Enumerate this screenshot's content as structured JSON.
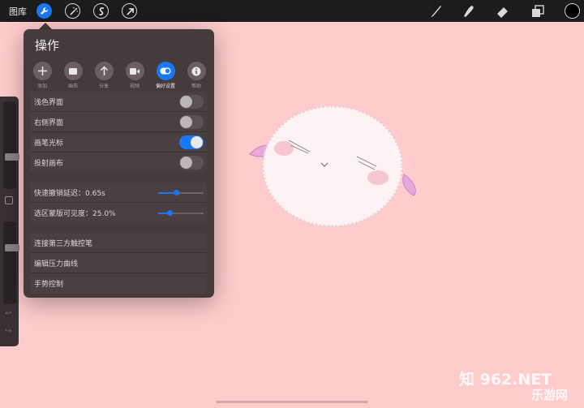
{
  "topbar": {
    "gallery_label": "图库",
    "left_tools": [
      "wrench-icon",
      "magic-wand-icon",
      "selection-icon",
      "transform-arrow-icon"
    ],
    "right_tools": [
      "brush-icon",
      "smudge-icon",
      "eraser-icon",
      "layers-icon"
    ],
    "current_color": "#000000"
  },
  "actions_panel": {
    "title": "操作",
    "tabs": [
      {
        "label": "添加",
        "icon": "plus-icon"
      },
      {
        "label": "画布",
        "icon": "canvas-icon"
      },
      {
        "label": "分享",
        "icon": "share-icon"
      },
      {
        "label": "视频",
        "icon": "video-icon"
      },
      {
        "label": "偏好设置",
        "icon": "toggle-icon",
        "active": true
      },
      {
        "label": "帮助",
        "icon": "info-icon"
      }
    ],
    "toggles": [
      {
        "label": "浅色界面",
        "on": false
      },
      {
        "label": "右侧界面",
        "on": false
      },
      {
        "label": "画笔光标",
        "on": true
      },
      {
        "label": "投射画布",
        "on": false
      }
    ],
    "sliders": [
      {
        "label": "快速撤销延迟：0.65s",
        "level": 0.4
      },
      {
        "label": "选区蒙版可见度：25.0%",
        "level": 0.25
      }
    ],
    "links": [
      "连接第三方触控笔",
      "编辑压力曲线",
      "手势控制"
    ]
  },
  "sidebar": {
    "brush_size_level": 0.35,
    "opacity_level": 0.7
  },
  "accent_color": "#1a78f2",
  "canvas_color": "#ffcccd",
  "watermark": {
    "main": "知 962.NET",
    "sub": "乐游网"
  }
}
